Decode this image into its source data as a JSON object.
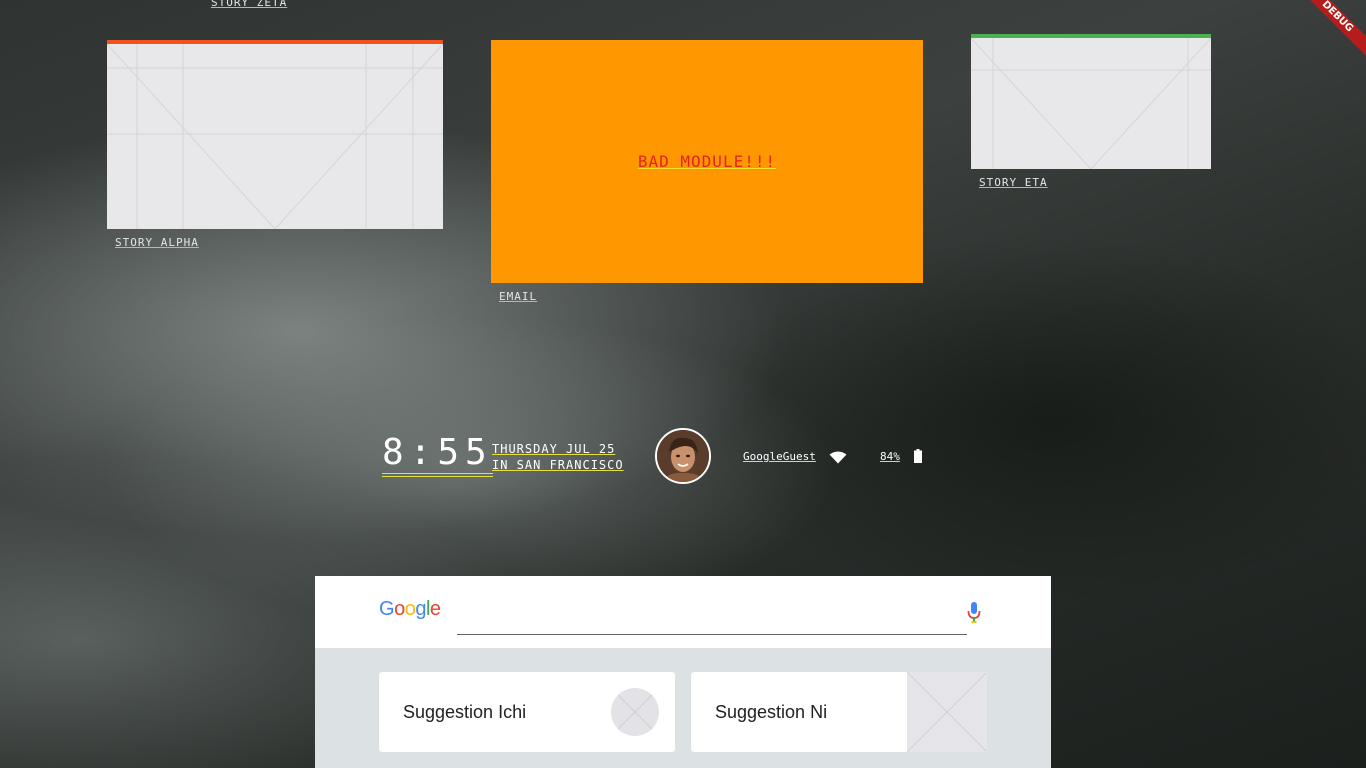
{
  "stories": {
    "zeta_label": "STORY ZETA",
    "alpha_label": "STORY ALPHA",
    "email_label": "EMAIL",
    "eta_label": "STORY ETA",
    "bad_module_text": "BAD MODULE!!!"
  },
  "debug_banner": "DEBUG",
  "status": {
    "time": "8:55",
    "date_line": "THURSDAY JUL 25",
    "location_line": "IN SAN FRANCISCO",
    "wifi_name": "GoogleGuest",
    "battery": "84%"
  },
  "search": {
    "logo": "Google",
    "placeholder": ""
  },
  "suggestions": [
    {
      "label": "Suggestion Ichi"
    },
    {
      "label": "Suggestion Ni"
    }
  ],
  "colors": {
    "alpha_accent": "#f4511e",
    "eta_accent": "#4caf50",
    "bad_module_bg": "#ff9800",
    "bad_module_text": "#e8231f",
    "underline": "#e6e03a"
  },
  "icons": [
    "wifi-icon",
    "battery-icon",
    "mic-icon",
    "avatar"
  ]
}
